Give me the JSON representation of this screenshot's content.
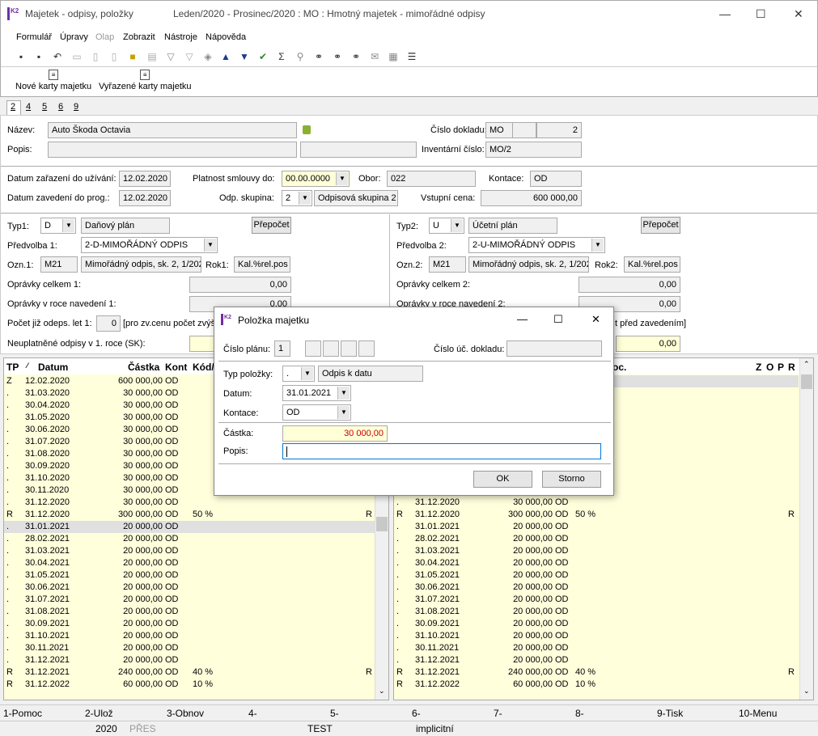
{
  "window": {
    "title": "Majetek - odpisy, položky",
    "subtitle": "Leden/2020 - Prosinec/2020 : MO : Hmotný majetek - mimořádné odpisy",
    "min": "—",
    "max": "☐",
    "close": "✕"
  },
  "menu": [
    "Formulář",
    "Úpravy",
    "Olap",
    "Zobrazit",
    "Nástroje",
    "Nápověda"
  ],
  "toolbar_big": {
    "new_cards": "Nové karty majetku",
    "discarded_cards": "Vyřazené karty majetku"
  },
  "tabs": [
    "2",
    "4",
    "5",
    "6",
    "9"
  ],
  "form": {
    "nazev_label": "Název:",
    "nazev": "Auto Škoda Octavia",
    "popis_label": "Popis:",
    "cislo_dokladu_label": "Číslo dokladu:",
    "cislo_dokladu_1": "MO",
    "cislo_dokladu_3": "2",
    "inv_cislo_label": "Inventární číslo:",
    "inv_cislo": "MO/2",
    "datum_zarazeni_label": "Datum zařazení do užívání:",
    "datum_zarazeni": "12.02.2020",
    "platnost_label": "Platnost smlouvy do:",
    "platnost": "00.00.0000",
    "obor_label": "Obor:",
    "obor": "022",
    "kontace_label": "Kontace:",
    "kontace": "OD",
    "datum_zavedeni_label": "Datum zavedení do prog.:",
    "datum_zavedeni": "12.02.2020",
    "odp_skupina_label": "Odp. skupina:",
    "odp_skupina": "2",
    "odp_skupina_text": "Odpisová skupina 2 (",
    "vstupni_cena_label": "Vstupní cena:",
    "vstupni_cena": "600 000,00",
    "typ1_label": "Typ1:",
    "typ1": "D",
    "typ1_text": "Daňový plán",
    "prepocet": "Přepočet",
    "predvolba1_label": "Předvolba 1:",
    "predvolba1": "2-D-MIMOŘÁDNÝ ODPIS",
    "ozn1_label": "Ozn.1:",
    "ozn1": "M21",
    "ozn1_text": "Mimořádný odpis, sk. 2, 1/202",
    "rok1_label": "Rok1:",
    "rok1": "Kal.%rel.pos",
    "opravky1_label": "Oprávky celkem 1:",
    "opravky1": "0,00",
    "opravky_roce1_label": "Oprávky v roce navedení 1:",
    "opravky_roce1": "0,00",
    "pocet_label": "Počet již odeps. let 1:",
    "pocet": "0",
    "pocet_note": "[pro zv.cenu počet zvýš",
    "neuplatnene_label": "Neuplatněné odpisy v 1. roce (SK):",
    "typ2_label": "Typ2:",
    "typ2": "U",
    "typ2_text": "Účetní plán",
    "predvolba2_label": "Předvolba 2:",
    "predvolba2": "2-U-MIMOŘÁDNÝ ODPIS",
    "ozn2_label": "Ozn.2:",
    "ozn2": "M21",
    "ozn2_text": "Mimořádný odpis, sk. 2, 1/202",
    "rok2_label": "Rok2:",
    "rok2": "Kal.%rel.pos",
    "opravky2_label": "Oprávky celkem 2:",
    "opravky2": "0,00",
    "opravky_roce2_label": "Oprávky v roce navedení 2:",
    "opravky_roce2": "0,00",
    "pred_zavedenim": "t před zavedením]",
    "right_value": "0,00"
  },
  "grid_headers": {
    "tp": "TP",
    "sort": "⁄",
    "datum": "Datum",
    "castka": "Částka",
    "kont": "Kont",
    "kod": "Kód/",
    "proc": "oc.",
    "z": "Z",
    "o": "O",
    "p": "P",
    "r": "R"
  },
  "left_rows": [
    {
      "tp": "Z",
      "datum": "12.02.2020",
      "castka": "600 000,00",
      "kont": "OD",
      "kod": "",
      "r": ""
    },
    {
      "tp": ".",
      "datum": "31.03.2020",
      "castka": "30 000,00",
      "kont": "OD",
      "kod": "",
      "r": ""
    },
    {
      "tp": ".",
      "datum": "30.04.2020",
      "castka": "30 000,00",
      "kont": "OD",
      "kod": "",
      "r": ""
    },
    {
      "tp": ".",
      "datum": "31.05.2020",
      "castka": "30 000,00",
      "kont": "OD",
      "kod": "",
      "r": ""
    },
    {
      "tp": ".",
      "datum": "30.06.2020",
      "castka": "30 000,00",
      "kont": "OD",
      "kod": "",
      "r": ""
    },
    {
      "tp": ".",
      "datum": "31.07.2020",
      "castka": "30 000,00",
      "kont": "OD",
      "kod": "",
      "r": ""
    },
    {
      "tp": ".",
      "datum": "31.08.2020",
      "castka": "30 000,00",
      "kont": "OD",
      "kod": "",
      "r": ""
    },
    {
      "tp": ".",
      "datum": "30.09.2020",
      "castka": "30 000,00",
      "kont": "OD",
      "kod": "",
      "r": ""
    },
    {
      "tp": ".",
      "datum": "31.10.2020",
      "castka": "30 000,00",
      "kont": "OD",
      "kod": "",
      "r": ""
    },
    {
      "tp": ".",
      "datum": "30.11.2020",
      "castka": "30 000,00",
      "kont": "OD",
      "kod": "",
      "r": ""
    },
    {
      "tp": ".",
      "datum": "31.12.2020",
      "castka": "30 000,00",
      "kont": "OD",
      "kod": "",
      "r": ""
    },
    {
      "tp": "R",
      "datum": "31.12.2020",
      "castka": "300 000,00",
      "kont": "OD",
      "kod": "50 %",
      "r": "R"
    },
    {
      "tp": ".",
      "datum": "31.01.2021",
      "castka": "20 000,00",
      "kont": "OD",
      "kod": "",
      "r": ""
    },
    {
      "tp": ".",
      "datum": "28.02.2021",
      "castka": "20 000,00",
      "kont": "OD",
      "kod": "",
      "r": ""
    },
    {
      "tp": ".",
      "datum": "31.03.2021",
      "castka": "20 000,00",
      "kont": "OD",
      "kod": "",
      "r": ""
    },
    {
      "tp": ".",
      "datum": "30.04.2021",
      "castka": "20 000,00",
      "kont": "OD",
      "kod": "",
      "r": ""
    },
    {
      "tp": ".",
      "datum": "31.05.2021",
      "castka": "20 000,00",
      "kont": "OD",
      "kod": "",
      "r": ""
    },
    {
      "tp": ".",
      "datum": "30.06.2021",
      "castka": "20 000,00",
      "kont": "OD",
      "kod": "",
      "r": ""
    },
    {
      "tp": ".",
      "datum": "31.07.2021",
      "castka": "20 000,00",
      "kont": "OD",
      "kod": "",
      "r": ""
    },
    {
      "tp": ".",
      "datum": "31.08.2021",
      "castka": "20 000,00",
      "kont": "OD",
      "kod": "",
      "r": ""
    },
    {
      "tp": ".",
      "datum": "30.09.2021",
      "castka": "20 000,00",
      "kont": "OD",
      "kod": "",
      "r": ""
    },
    {
      "tp": ".",
      "datum": "31.10.2021",
      "castka": "20 000,00",
      "kont": "OD",
      "kod": "",
      "r": ""
    },
    {
      "tp": ".",
      "datum": "30.11.2021",
      "castka": "20 000,00",
      "kont": "OD",
      "kod": "",
      "r": ""
    },
    {
      "tp": ".",
      "datum": "31.12.2021",
      "castka": "20 000,00",
      "kont": "OD",
      "kod": "",
      "r": ""
    },
    {
      "tp": "R",
      "datum": "31.12.2021",
      "castka": "240 000,00",
      "kont": "OD",
      "kod": "40 %",
      "r": "R"
    },
    {
      "tp": "R",
      "datum": "31.12.2022",
      "castka": "60 000,00",
      "kont": "OD",
      "kod": "10 %",
      "r": ""
    }
  ],
  "right_rows": [
    {
      "tp": ".",
      "datum": "31.12.2020",
      "castka": "30 000,00",
      "kont": "OD",
      "kod": "",
      "r": ""
    },
    {
      "tp": "R",
      "datum": "31.12.2020",
      "castka": "300 000,00",
      "kont": "OD",
      "kod": "50 %",
      "r": "R"
    },
    {
      "tp": ".",
      "datum": "31.01.2021",
      "castka": "20 000,00",
      "kont": "OD",
      "kod": "",
      "r": ""
    },
    {
      "tp": ".",
      "datum": "28.02.2021",
      "castka": "20 000,00",
      "kont": "OD",
      "kod": "",
      "r": ""
    },
    {
      "tp": ".",
      "datum": "31.03.2021",
      "castka": "20 000,00",
      "kont": "OD",
      "kod": "",
      "r": ""
    },
    {
      "tp": ".",
      "datum": "30.04.2021",
      "castka": "20 000,00",
      "kont": "OD",
      "kod": "",
      "r": ""
    },
    {
      "tp": ".",
      "datum": "31.05.2021",
      "castka": "20 000,00",
      "kont": "OD",
      "kod": "",
      "r": ""
    },
    {
      "tp": ".",
      "datum": "30.06.2021",
      "castka": "20 000,00",
      "kont": "OD",
      "kod": "",
      "r": ""
    },
    {
      "tp": ".",
      "datum": "31.07.2021",
      "castka": "20 000,00",
      "kont": "OD",
      "kod": "",
      "r": ""
    },
    {
      "tp": ".",
      "datum": "31.08.2021",
      "castka": "20 000,00",
      "kont": "OD",
      "kod": "",
      "r": ""
    },
    {
      "tp": ".",
      "datum": "30.09.2021",
      "castka": "20 000,00",
      "kont": "OD",
      "kod": "",
      "r": ""
    },
    {
      "tp": ".",
      "datum": "31.10.2021",
      "castka": "20 000,00",
      "kont": "OD",
      "kod": "",
      "r": ""
    },
    {
      "tp": ".",
      "datum": "30.11.2021",
      "castka": "20 000,00",
      "kont": "OD",
      "kod": "",
      "r": ""
    },
    {
      "tp": ".",
      "datum": "31.12.2021",
      "castka": "20 000,00",
      "kont": "OD",
      "kod": "",
      "r": ""
    },
    {
      "tp": "R",
      "datum": "31.12.2021",
      "castka": "240 000,00",
      "kont": "OD",
      "kod": "40 %",
      "r": "R"
    },
    {
      "tp": "R",
      "datum": "31.12.2022",
      "castka": "60 000,00",
      "kont": "OD",
      "kod": "10 %",
      "r": ""
    }
  ],
  "dialog": {
    "title": "Položka majetku",
    "min": "—",
    "max": "☐",
    "close": "✕",
    "cislo_planu_label": "Číslo plánu:",
    "cislo_planu": "1",
    "cislo_uc_label": "Číslo úč. dokladu:",
    "typ_polozky_label": "Typ položky:",
    "typ_polozky": ".",
    "typ_polozky_text": "Odpis k datu",
    "datum_label": "Datum:",
    "datum": "31.01.2021",
    "kontace_label": "Kontace:",
    "kontace": "OD",
    "castka_label": "Částka:",
    "castka": "30 000,00",
    "popis_label": "Popis:",
    "ok": "OK",
    "storno": "Storno"
  },
  "status": [
    "1-Pomoc",
    "2-Ulož",
    "3-Obnov",
    "4-",
    "5-",
    "6-",
    "7-",
    "8-",
    "9-Tisk",
    "10-Menu"
  ],
  "status2": {
    "year": "2020",
    "pres": "PŘES",
    "db": "TEST",
    "mode": "implicitní"
  },
  "colors": {
    "grid_bg": "#ffffdc",
    "red_value": "#cc0000",
    "focus": "#0078d7"
  }
}
